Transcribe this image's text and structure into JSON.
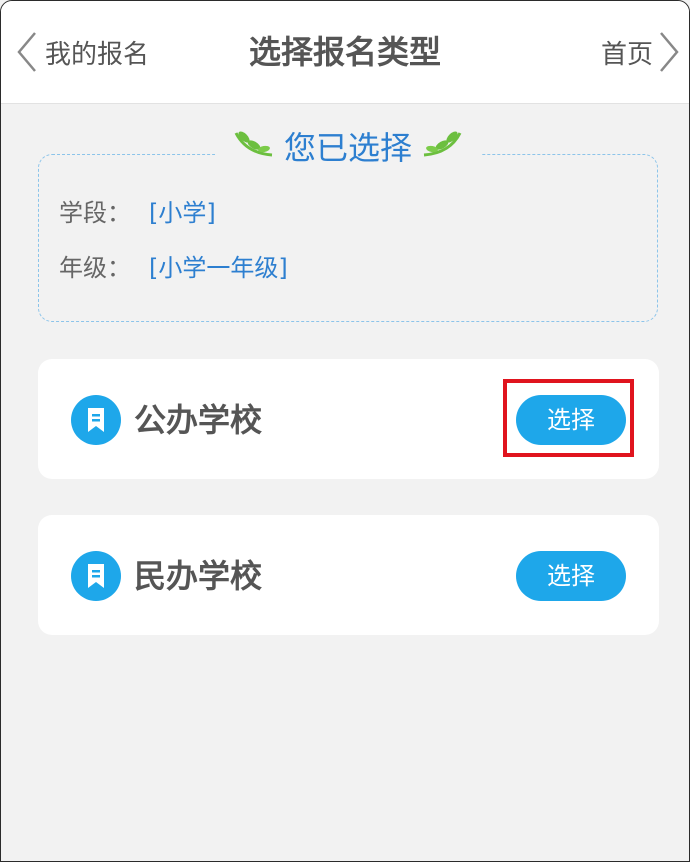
{
  "header": {
    "back_label": "我的报名",
    "title": "选择报名类型",
    "home_label": "首页"
  },
  "selected": {
    "heading": "您已选择",
    "rows": [
      {
        "key": "学段：",
        "value": "[小学]"
      },
      {
        "key": "年级：",
        "value": "[小学一年级]"
      }
    ]
  },
  "options": [
    {
      "name": "公办学校",
      "button": "选择"
    },
    {
      "name": "民办学校",
      "button": "选择"
    }
  ],
  "colors": {
    "accent": "#1ea7ea",
    "value_text": "#2d7fd0",
    "highlight": "#e0141e",
    "leaf": "#6cbf3f"
  },
  "icons": {
    "back": "chevron-left-icon",
    "home": "chevron-right-icon",
    "heading_decor": "leaf-sprig-icon",
    "school": "bookmark-icon"
  }
}
